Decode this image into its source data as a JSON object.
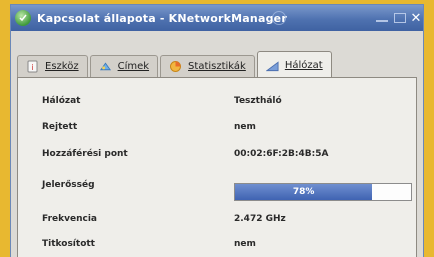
{
  "window": {
    "title": "Kapcsolat állapota - KNetworkManager",
    "icons": {
      "app": "network-status-icon",
      "close": "close-icon"
    }
  },
  "tabs": [
    {
      "label": "Eszköz",
      "icon": "device-icon",
      "active": false
    },
    {
      "label": "Címek",
      "icon": "address-icon",
      "active": false
    },
    {
      "label": "Statisztikák",
      "icon": "statistics-icon",
      "active": false
    },
    {
      "label": "Hálózat",
      "icon": "signal-bars-icon",
      "active": true
    }
  ],
  "details": [
    {
      "label": "Hálózat",
      "value": "Tesztháló"
    },
    {
      "label": "Rejtett",
      "value": "nem"
    },
    {
      "label": "Hozzáférési pont",
      "value": "00:02:6F:2B:4B:5A"
    },
    {
      "label": "Jelerősség",
      "value": "78%"
    },
    {
      "label": "Frekvencia",
      "value": "2.472 GHz"
    },
    {
      "label": "Titkosított",
      "value": "nem"
    }
  ],
  "signal_strength_percent": 78,
  "colors": {
    "background": "#e8b830",
    "titlebar": "#4f72b0",
    "progress": "#3f63b2"
  }
}
